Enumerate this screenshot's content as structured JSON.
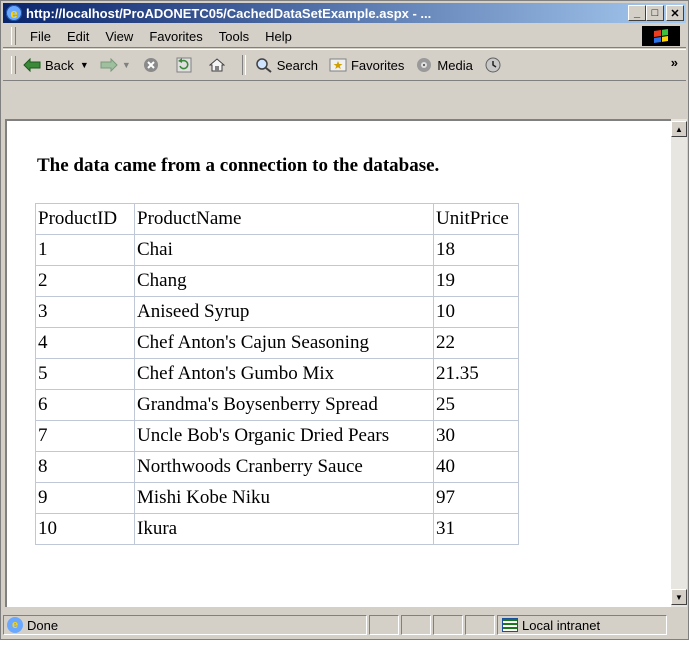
{
  "window": {
    "title": "http://localhost/ProADONETC05/CachedDataSetExample.aspx - ..."
  },
  "menu": {
    "items": [
      "File",
      "Edit",
      "View",
      "Favorites",
      "Tools",
      "Help"
    ]
  },
  "toolbar": {
    "back_label": "Back",
    "search_label": "Search",
    "favorites_label": "Favorites",
    "media_label": "Media",
    "more_label": "»"
  },
  "page": {
    "heading": "The data came from a connection to the database.",
    "columns": [
      "ProductID",
      "ProductName",
      "UnitPrice"
    ],
    "rows": [
      [
        "1",
        "Chai",
        "18"
      ],
      [
        "2",
        "Chang",
        "19"
      ],
      [
        "3",
        "Aniseed Syrup",
        "10"
      ],
      [
        "4",
        "Chef Anton's Cajun Seasoning",
        "22"
      ],
      [
        "5",
        "Chef Anton's Gumbo Mix",
        "21.35"
      ],
      [
        "6",
        "Grandma's Boysenberry Spread",
        "25"
      ],
      [
        "7",
        "Uncle Bob's Organic Dried Pears",
        "30"
      ],
      [
        "8",
        "Northwoods Cranberry Sauce",
        "40"
      ],
      [
        "9",
        "Mishi Kobe Niku",
        "97"
      ],
      [
        "10",
        "Ikura",
        "31"
      ]
    ]
  },
  "status": {
    "text": "Done",
    "zone": "Local intranet"
  },
  "icons": {
    "ie": "internet-explorer-icon",
    "back": "back-arrow-icon",
    "forward": "forward-arrow-icon",
    "stop": "stop-icon",
    "refresh": "refresh-icon",
    "home": "home-icon",
    "search": "search-icon",
    "favorites": "favorites-icon",
    "media": "media-icon",
    "history": "history-icon",
    "windows": "windows-logo-icon",
    "zone": "local-intranet-icon"
  }
}
